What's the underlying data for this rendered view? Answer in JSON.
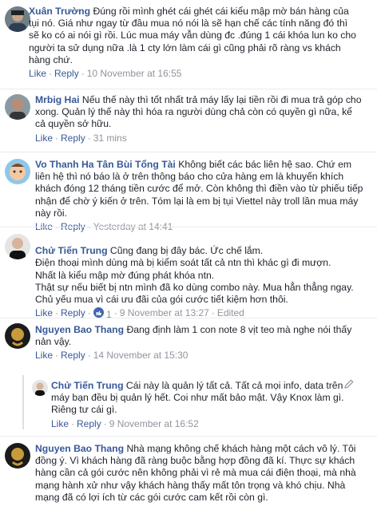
{
  "comments": [
    {
      "author": "Xuân Trường",
      "text": "Đúng rồi mình ghét cái ghét cái kiểu mập mờ bán hàng của tụi nó. Giá như ngay từ đầu mua nó nói là sẽ hạn chế các tính năng đó thì sẽ ko có ai nói gì rồi. Lúc mua máy vẫn dùng đc .đúng 1 cái khóa lun ko cho người ta sử dụng nữa .là 1 cty lớn làm cái gì cũng phải rõ ràng vs khách hàng chứ.",
      "like": "Like",
      "reply": "Reply",
      "time": "10 November at 16:55"
    },
    {
      "author": "Mrbig Hai",
      "text": "Nếu thế này thì tốt nhất trả máy lấy lại tiền rồi đi mua trả góp cho xong. Quản lý thế này thì hóa ra người dùng chả còn có quyền gì nữa, kể cả quyền sở hữu.",
      "like": "Like",
      "reply": "Reply",
      "time": "31 mins"
    },
    {
      "author": "Vo Thanh Ha Tân Bùi Tổng Tài",
      "text": "Không biết các bác liên hệ sao. Chứ em liên hệ thì nó báo là ở trên thông báo cho cửa hàng em là khuyến khích khách đóng 12 tháng tiền cước để mở. Còn không thì điền vào từ phiếu tiếp nhận để chờ ý kiến ở trên. Tóm lại là em bị tụi Viettel này troll lần mua máy này rồi.",
      "like": "Like",
      "reply": "Reply",
      "time": "Yesterday at 14:41"
    },
    {
      "author": "Chử Tiến Trung",
      "text": "Cũng đang bị đây bác. Ức chế lắm.\nĐiện thoại mình dùng mà bị kiểm soát tất cả ntn thì khác gì đi mượn.\nNhất là kiểu mập mờ đúng phát khóa ntn.\nThật sự nếu biết bị ntn mình đã ko dùng combo này. Mua hẳn thẳng ngay.\nChủ yếu mua vì cái ưu đãi của gói cước tiết kiệm hơn thôi.",
      "like": "Like",
      "reply": "Reply",
      "likes_count": "1",
      "time": "9 November at 13:27",
      "edited": "Edited"
    },
    {
      "author": "Nguyen Bao Thang",
      "text": "Đang định làm 1 con note 8 vịt teo mà nghe nói thấy nản vậy.",
      "like": "Like",
      "reply": "Reply",
      "time": "14 November at 15:30"
    },
    {
      "author": "Chử Tiến Trung",
      "text": "Cái này là quản lý tất cả. Tất cả mọi info, data trên máy bạn đều bị quản lý hết. Coi như mất bảo mật. Vậy Knox làm gì. Riêng tư cái gì.",
      "like": "Like",
      "reply": "Reply",
      "time": "9 November at 16:52"
    },
    {
      "author": "Nguyen Bao Thang",
      "text": "Nhà mạng không chế khách hàng một cách vô lý. Tôi đồng ý. Vì khách hàng đã ràng buộc bằng hợp đồng đã kí. Thực sự khách hàng cần cả gói cước nên không phải vì rẻ mà mua cái điện thoại, mà nhà mạng hành xử như vậy khách hàng thấy mất tôn trọng và khó chịu. Nhà mạng đã có lợi ích từ các gói cước cam kết rồi còn gì.",
      "like": "",
      "reply": "",
      "time": ""
    }
  ],
  "colors": {
    "link": "#385898",
    "meta": "#90949c",
    "text": "#1d2129",
    "divider": "#e9ebee",
    "like_blue": "#4267b2"
  }
}
